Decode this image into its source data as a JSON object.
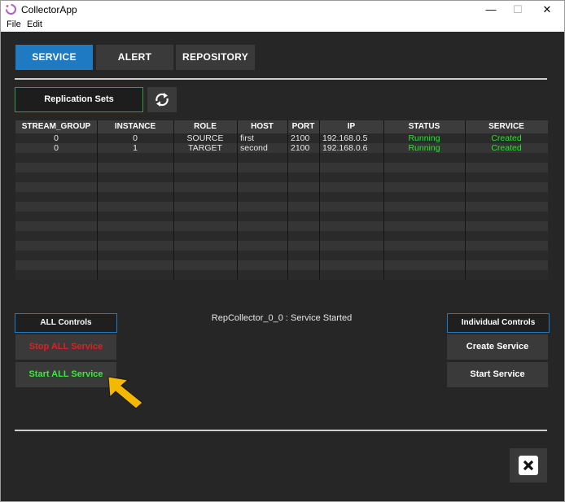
{
  "window": {
    "title": "CollectorApp",
    "controls": {
      "minimize": "—",
      "maximize": "☐",
      "close": "✕"
    }
  },
  "menu": [
    "File",
    "Edit"
  ],
  "tabs": [
    {
      "label": "SERVICE",
      "active": true
    },
    {
      "label": "ALERT",
      "active": false
    },
    {
      "label": "REPOSITORY",
      "active": false
    }
  ],
  "replication": {
    "label": "Replication Sets",
    "refresh_icon": "refresh-icon"
  },
  "table": {
    "columns": [
      "STREAM_GROUP",
      "INSTANCE",
      "ROLE",
      "HOST",
      "PORT",
      "IP",
      "STATUS",
      "SERVICE"
    ],
    "rows": [
      [
        "0",
        "0",
        "SOURCE",
        "first",
        "2100",
        "192.168.0.5",
        "Running",
        "Created"
      ],
      [
        "0",
        "1",
        "TARGET",
        "second",
        "2100",
        "192.168.0.6",
        "Running",
        "Created"
      ]
    ]
  },
  "status_message": "RepCollector_0_0 : Service Started",
  "all_controls": {
    "label": "ALL Controls",
    "stop": "Stop ALL Service",
    "start": "Start ALL Service"
  },
  "individual_controls": {
    "label": "Individual Controls",
    "create": "Create Service",
    "start": "Start Service"
  },
  "colors": {
    "accent": "#1f7ac4",
    "running": "#27e627",
    "stop": "#e02020",
    "background": "#262626",
    "pointer": "#f5b800"
  }
}
